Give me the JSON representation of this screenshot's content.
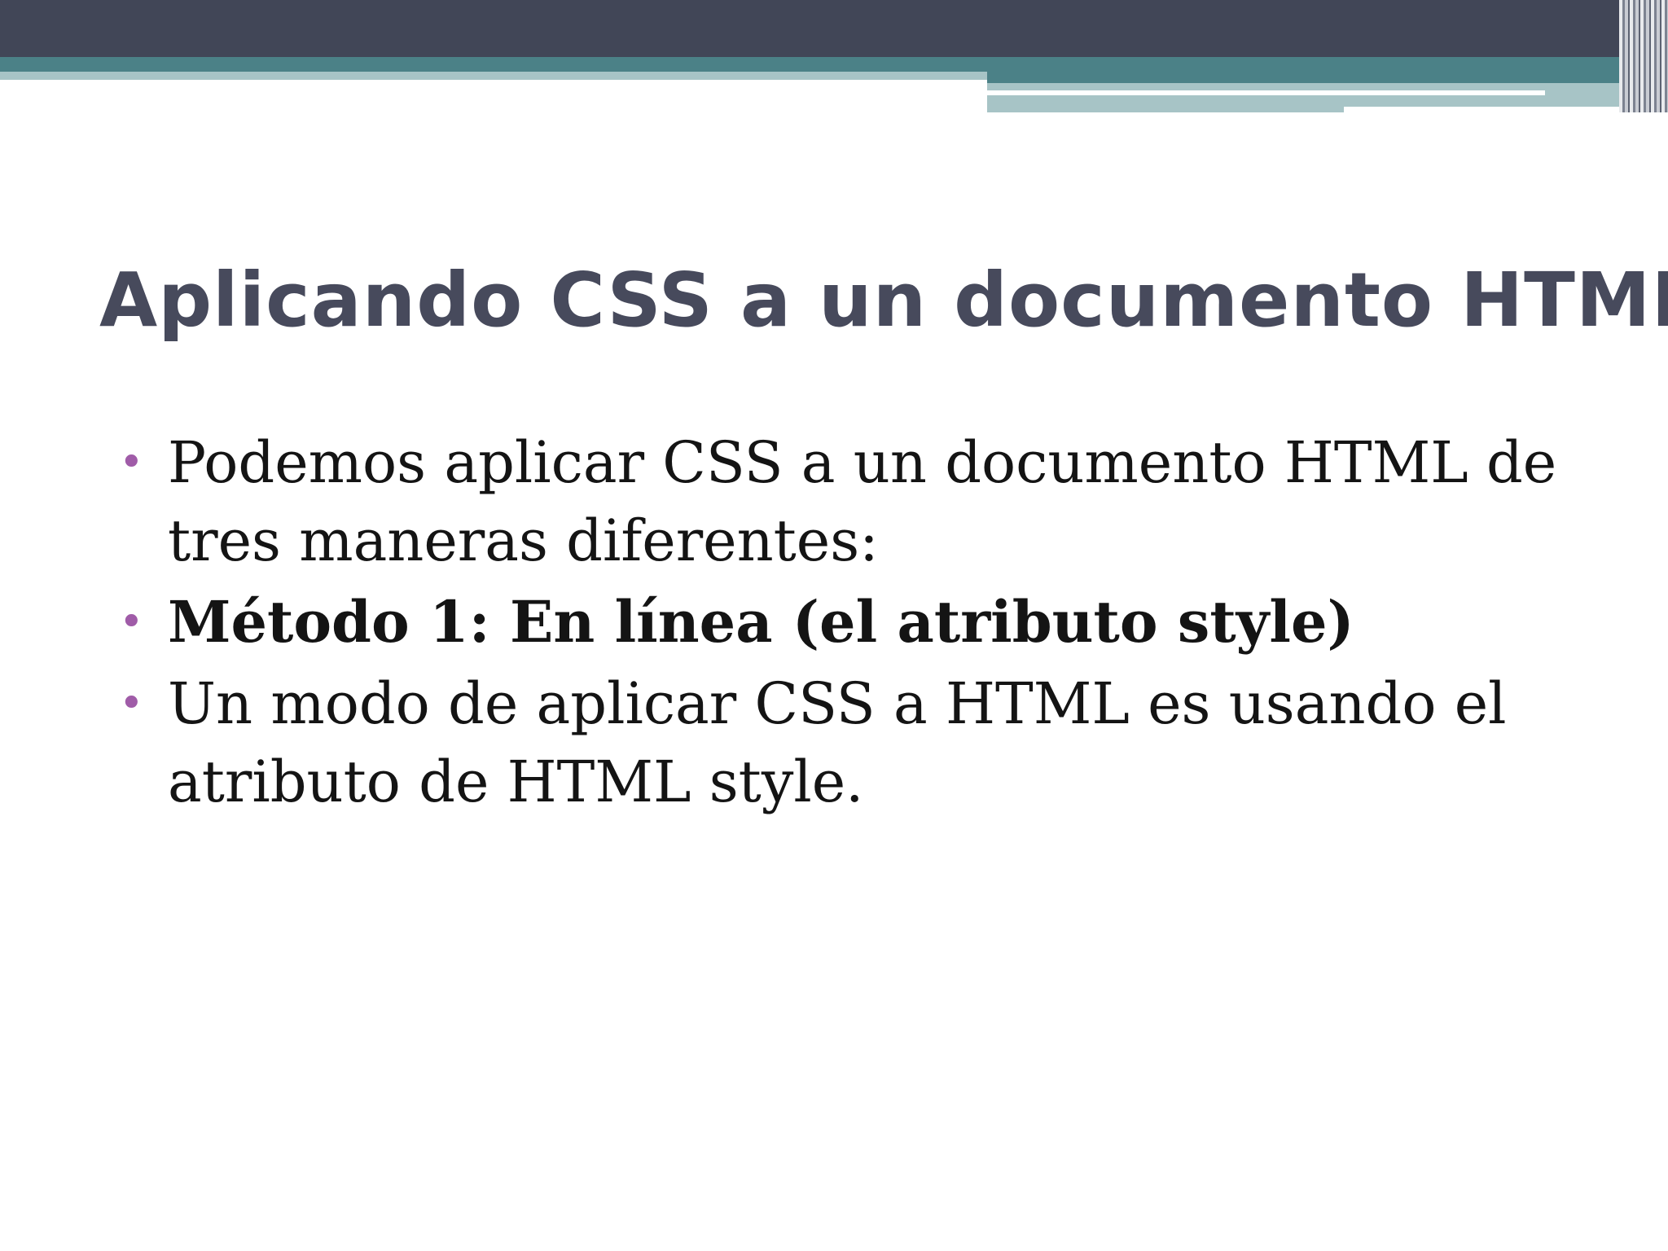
{
  "colors": {
    "header_dark": "#414657",
    "header_teal": "#4b8187",
    "header_light": "#a7c4c6",
    "title": "#474a5c",
    "bullet": "#a05ca8",
    "body_text": "#141414"
  },
  "slide": {
    "title": "Aplicando CSS a un documento HTML",
    "bullet_symbol": "•",
    "items": [
      {
        "text": "Podemos aplicar CSS a un documento HTML de tres maneras diferentes:",
        "bold": false
      },
      {
        "text": "Método 1: En línea (el atributo style)",
        "bold": true
      },
      {
        "text": "Un modo de aplicar CSS a HTML es usando el atributo de HTML style.",
        "bold": false
      }
    ]
  }
}
